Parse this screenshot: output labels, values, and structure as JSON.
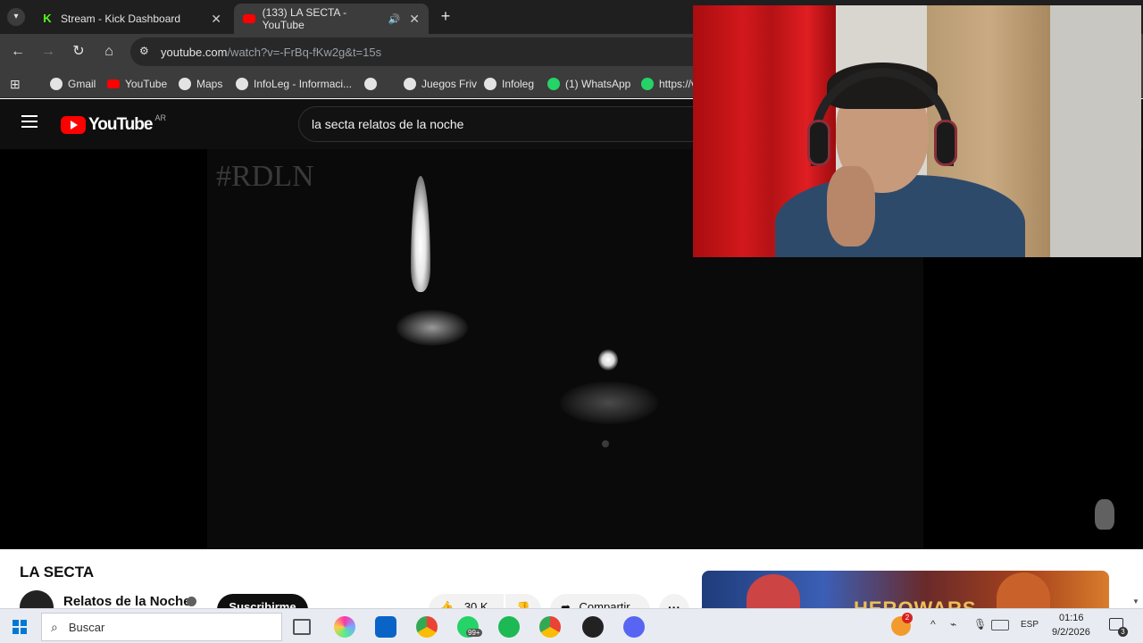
{
  "browser": {
    "tabs": [
      {
        "label": "Stream - Kick Dashboard",
        "active": false
      },
      {
        "label": "(133) LA SECTA - YouTube",
        "active": true
      }
    ],
    "new_tab": "+",
    "url_host": "youtube.com",
    "url_path": "/watch?v=-FrBq-fKw2g&t=15s",
    "bookmarks": [
      "Gmail",
      "YouTube",
      "Maps",
      "InfoLeg - Informaci...",
      "",
      "Juegos Friv",
      "Infoleg",
      "(1) WhatsApp",
      "https://v"
    ]
  },
  "youtube": {
    "logo_text": "YouTube",
    "region": "AR",
    "search_value": "la secta relatos de la noche",
    "watermark": "#RDLN",
    "video_title": "LA SECTA",
    "channel_name": "Relatos de la Noche",
    "subscribe_label": "Suscribirme",
    "likes": "30 K",
    "share_label": "Compartir",
    "more_label": "···",
    "ad_text": "HEROWARS"
  },
  "taskbar": {
    "search_placeholder": "Buscar",
    "whatsapp_badge": "99+",
    "ad_badge": "2",
    "language": "ESP",
    "time": "01:16",
    "date": "9/2/2026",
    "notif_count": "3"
  },
  "colors": {
    "browser_dark": "#1f1f1f",
    "toolbar": "#3c3c3c",
    "youtube_red": "#ff0000",
    "kick_green": "#53fc18",
    "subscribe_bg": "#0f0f0f"
  }
}
